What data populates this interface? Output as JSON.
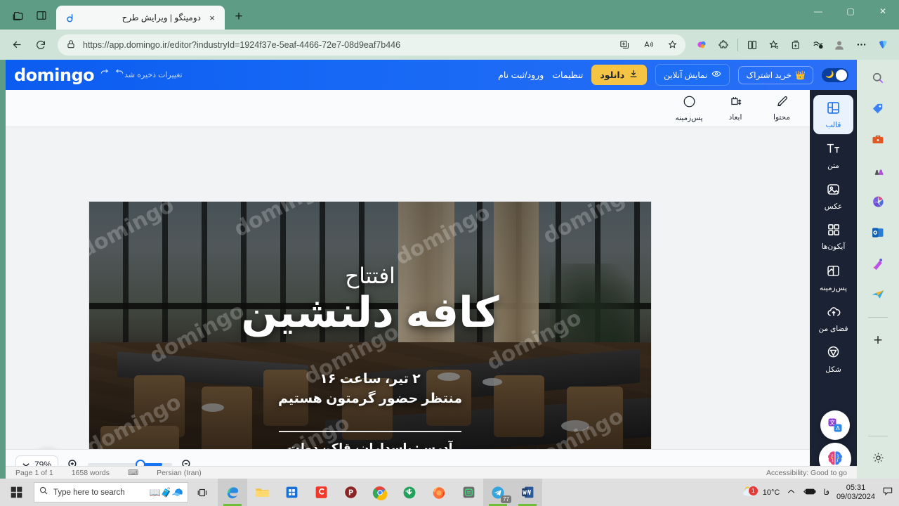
{
  "browser": {
    "tab": {
      "title": "دومینگو | ویرایش طرح",
      "favicon": "domingo-d-icon",
      "close": "×"
    },
    "newtab_label": "+",
    "window_controls": {
      "minimize": "—",
      "maximize": "▢",
      "close": "✕"
    },
    "address": {
      "url_prefix": "https://",
      "url_domain": "app.domingo.ir",
      "url_path": "/editor?industryId=1924f37e-5eaf-4466-72e7-08d9eaf7b446",
      "url_full": "https://app.domingo.ir/editor?industryId=1924f37e-5eaf-4466-72e7-08d9eaf7b446",
      "lock_icon": "lock-icon"
    },
    "nav": {
      "back": "back-icon",
      "reload": "reload-icon"
    },
    "toolbar_icons": [
      "split-screen-icon",
      "read-aloud-icon",
      "favorite-star-icon",
      "copilot-brain-icon",
      "extensions-puzzle-icon",
      "split-window-icon",
      "favorites-list-icon",
      "collections-icon",
      "browser-essentials-icon",
      "profile-avatar-icon",
      "more-settings-icon",
      "copilot-icon"
    ]
  },
  "app": {
    "logo": "domingo",
    "save_status": "تغییرات ذخیره شد",
    "undo_icon": "undo-icon",
    "redo_icon": "redo-icon",
    "dark_mode_toggle": {
      "state": "on",
      "icon": "moon-icon"
    },
    "buttons": {
      "subscribe": {
        "label": "خرید اشتراک",
        "icon": "crown-icon"
      },
      "preview": {
        "label": "نمایش آنلاین",
        "icon": "eye-icon"
      },
      "download": {
        "label": "دانلود",
        "icon": "download-icon",
        "color": "#f6c445"
      }
    },
    "links": {
      "settings": "تنظیمات",
      "login": "ورود/ثبت نام"
    },
    "toolbar": [
      {
        "label": "محتوا",
        "icon": "pencil-edit-icon"
      },
      {
        "label": "ابعاد",
        "icon": "resize-icon"
      },
      {
        "label": "پس‌زمینه",
        "icon": "circle-color-icon"
      }
    ],
    "sidebar": [
      {
        "label": "قالب",
        "icon": "template-grid-icon",
        "active": true
      },
      {
        "label": "متن",
        "icon": "text-Tt-icon",
        "active": false
      },
      {
        "label": "عکس",
        "icon": "image-icon",
        "active": false
      },
      {
        "label": "آیکون‌ها",
        "icon": "four-squares-icon",
        "active": false
      },
      {
        "label": "پس‌زمینه",
        "icon": "background-panel-icon",
        "active": false
      },
      {
        "label": "فضای من",
        "icon": "cloud-upload-icon",
        "active": false
      },
      {
        "label": "شکل",
        "icon": "shape-triangle-icon",
        "active": false
      }
    ],
    "floating": {
      "magic": "magic-wand-icon",
      "translate": "translate-icon",
      "ai": "ai-brain-icon"
    },
    "bottom": {
      "zoom_value": "79%",
      "zoom_in_icon": "zoom-in-icon",
      "zoom_out_icon": "zoom-out-icon",
      "chevron": "chevron-down-icon",
      "collapse_icon": "chevron-up-icon"
    },
    "canvas": {
      "watermark_text": "domingo",
      "poster": {
        "eyebrow": "افتتاح",
        "title": "کافه دلنشین",
        "line1": "۲ تیر، ساعت ۱۶",
        "line2": "منتظر حضور گرمتون هستیم",
        "address": "آدرس: پاسداران، قلک، دولت"
      }
    }
  },
  "word_status": {
    "page": "Page 1 of 1",
    "words": "1658 words",
    "proof_icon": "proofing-icon",
    "language": "Persian (Iran)",
    "accessibility": "Accessibility: Good to go"
  },
  "edge_sidebar": {
    "icons": [
      "search-icon",
      "shopping-tag-icon",
      "tools-briefcase-icon",
      "games-icon",
      "office-icon",
      "outlook-icon",
      "image-creator-icon",
      "telegram-paperplane-icon"
    ],
    "add_label": "+",
    "settings_icon": "gear-icon"
  },
  "taskbar": {
    "start_icon": "windows-start-icon",
    "search_placeholder": "Type here to search",
    "search_emojis": "📖🧳🧢",
    "task_view_icon": "task-view-icon",
    "apps": [
      {
        "name": "edge-icon",
        "active": true,
        "badge": ""
      },
      {
        "name": "file-explorer-icon",
        "active": false,
        "badge": ""
      },
      {
        "name": "microsoft-store-icon",
        "active": false,
        "badge": ""
      },
      {
        "name": "camtasia-icon",
        "active": false,
        "badge": ""
      },
      {
        "name": "pycharm-icon",
        "active": false,
        "badge": ""
      },
      {
        "name": "chrome-icon",
        "active": false,
        "badge": ""
      },
      {
        "name": "idm-icon",
        "active": false,
        "badge": ""
      },
      {
        "name": "firefox-icon",
        "active": false,
        "badge": ""
      },
      {
        "name": "notepad-green-icon",
        "active": false,
        "badge": ""
      },
      {
        "name": "telegram-icon",
        "active": true,
        "badge": "77"
      },
      {
        "name": "word-icon",
        "active": true,
        "badge": ""
      }
    ],
    "tray": {
      "weather_temp": "10°C",
      "weather_badge": "1",
      "chevron_icon": "show-hidden-icons-icon",
      "battery_icon": "battery-charging-icon",
      "language": "فا",
      "time": "05:31",
      "date": "09/03/2024",
      "notification_icon": "notification-icon"
    }
  }
}
